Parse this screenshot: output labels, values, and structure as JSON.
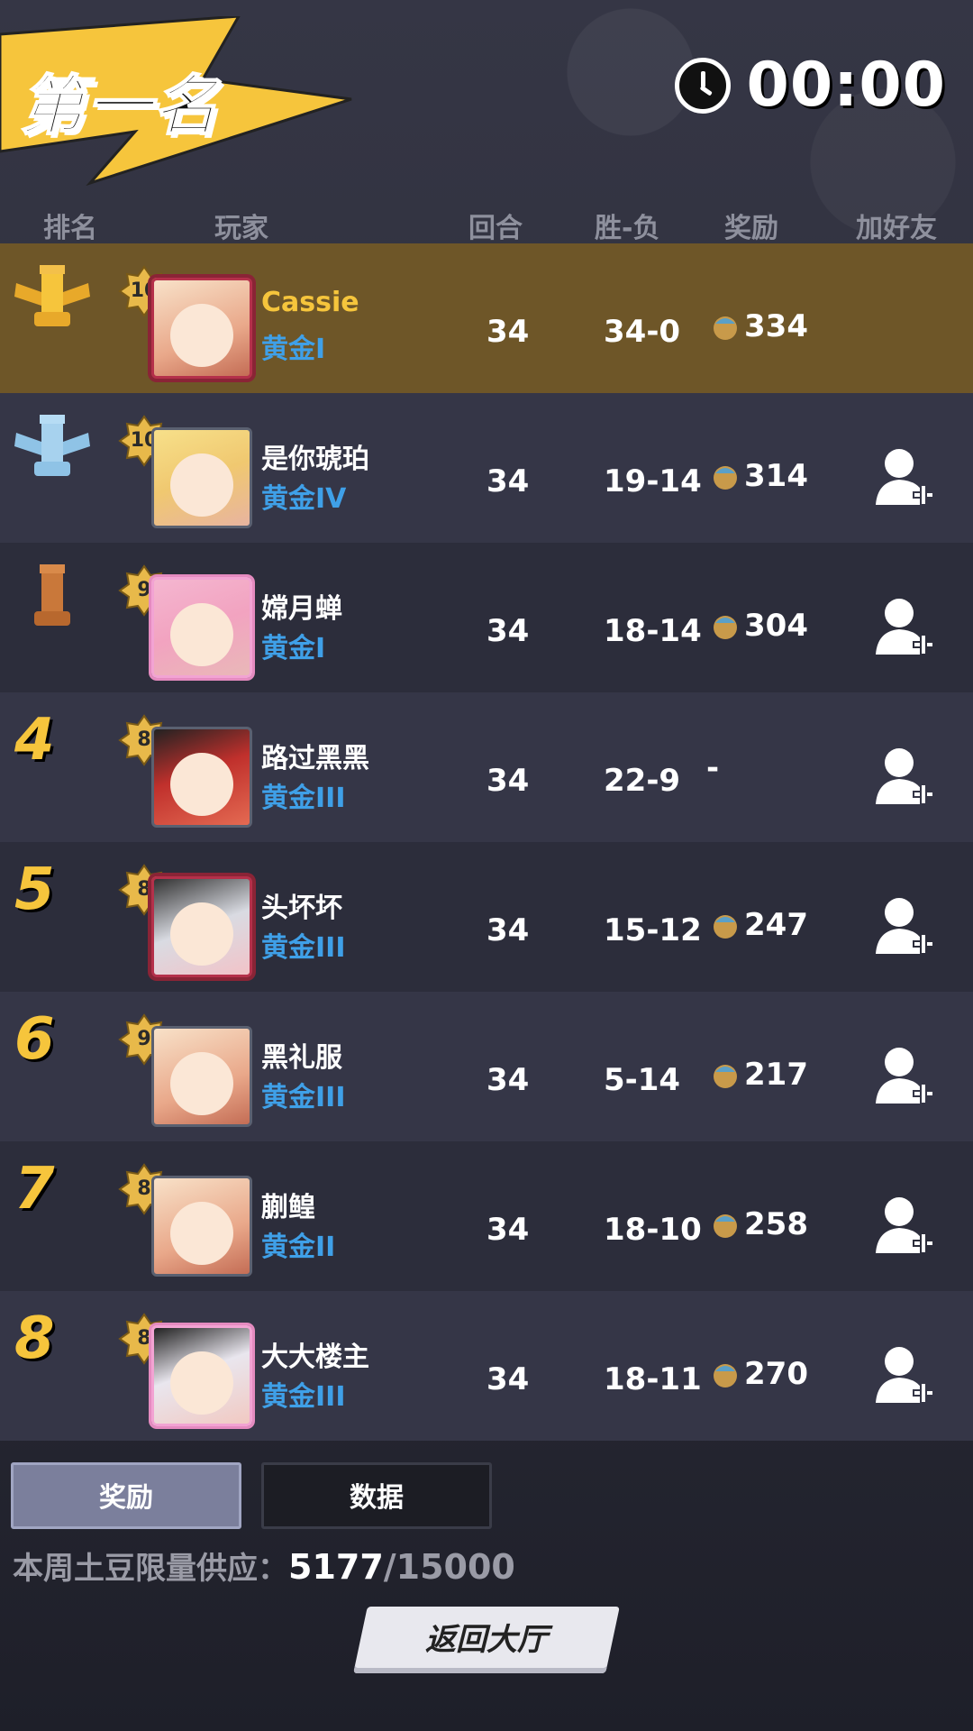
{
  "header": {
    "title": "第一名",
    "timer": "00:00"
  },
  "columns": {
    "rank": "排名",
    "player": "玩家",
    "rounds": "回合",
    "win_loss": "胜-负",
    "reward": "奖励",
    "add_friend": "加好友"
  },
  "rows": [
    {
      "rank": "1",
      "level": "10",
      "name": "Cassie",
      "tier": "黄金I",
      "rounds": "34",
      "win_loss": "34-0",
      "reward": "334"
    },
    {
      "rank": "2",
      "level": "10",
      "name": "是你琥珀",
      "tier": "黄金IV",
      "rounds": "34",
      "win_loss": "19-14",
      "reward": "314"
    },
    {
      "rank": "3",
      "level": "9",
      "name": "嫦月蝉",
      "tier": "黄金I",
      "rounds": "34",
      "win_loss": "18-14",
      "reward": "304"
    },
    {
      "rank": "4",
      "level": "8",
      "name": "路过黑黑",
      "tier": "黄金III",
      "rounds": "34",
      "win_loss": "22-9",
      "reward": "-"
    },
    {
      "rank": "5",
      "level": "8",
      "name": "头坏坏",
      "tier": "黄金III",
      "rounds": "34",
      "win_loss": "15-12",
      "reward": "247"
    },
    {
      "rank": "6",
      "level": "9",
      "name": "黑礼服",
      "tier": "黄金III",
      "rounds": "34",
      "win_loss": "5-14",
      "reward": "217"
    },
    {
      "rank": "7",
      "level": "8",
      "name": "蒯鳇",
      "tier": "黄金II",
      "rounds": "34",
      "win_loss": "18-10",
      "reward": "258"
    },
    {
      "rank": "8",
      "level": "8",
      "name": "大大楼主",
      "tier": "黄金III",
      "rounds": "34",
      "win_loss": "18-11",
      "reward": "270"
    }
  ],
  "tabs": {
    "reward": "奖励",
    "data": "数据"
  },
  "supply": {
    "label": "本周土豆限量供应：",
    "current": "5177",
    "total": "/15000"
  },
  "back_button": "返回大厅",
  "colors": {
    "gold": "#f6c53c",
    "tier_blue": "#3fa0e8",
    "highlight_row": "#6e5628"
  },
  "icons": {
    "timer": "clock-icon",
    "add_friend": "add-friend-icon",
    "reward": "potato-coin-icon",
    "rank1": "gold-chess-rook-icon",
    "rank2": "silver-chess-rook-icon",
    "rank3": "bronze-chess-rook-icon"
  }
}
